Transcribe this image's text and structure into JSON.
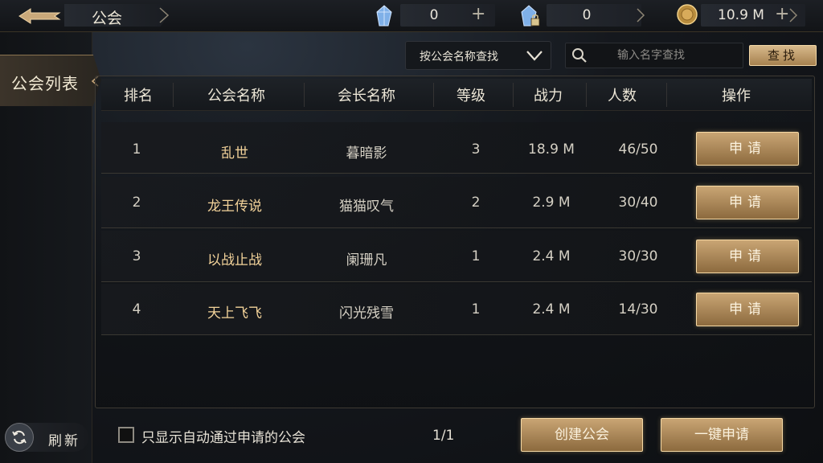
{
  "header": {
    "title": "公会",
    "currencies": [
      {
        "icon": "blue-crystal-icon",
        "value": "0",
        "has_plus": true
      },
      {
        "icon": "locked-crystal-icon",
        "value": "0",
        "has_plus": false
      },
      {
        "icon": "gold-coin-icon",
        "value": "10.9 M",
        "has_plus": true
      }
    ]
  },
  "side_tab": {
    "label": "公会列表"
  },
  "search": {
    "type_label": "按公会名称查找",
    "placeholder": "输入名字查找",
    "button_label": "查找"
  },
  "table": {
    "columns": [
      "排名",
      "公会名称",
      "会长名称",
      "等级",
      "战力",
      "人数",
      "操作"
    ],
    "rows": [
      {
        "rank": "1",
        "guild": "乱世",
        "leader": "暮暗影",
        "level": "3",
        "power": "18.9 M",
        "members": "46/50",
        "action": "申请"
      },
      {
        "rank": "2",
        "guild": "龙王传说",
        "leader": "猫猫叹气",
        "level": "2",
        "power": "2.9 M",
        "members": "30/40",
        "action": "申请"
      },
      {
        "rank": "3",
        "guild": "以战止战",
        "leader": "阑珊凡",
        "level": "1",
        "power": "2.4 M",
        "members": "30/30",
        "action": "申请"
      },
      {
        "rank": "4",
        "guild": "天上飞飞",
        "leader": "闪光残雪",
        "level": "1",
        "power": "2.4 M",
        "members": "14/30",
        "action": "申请"
      }
    ]
  },
  "footer": {
    "refresh_label": "刷新",
    "auto_filter_label": "只显示自动通过申请的公会",
    "auto_filter_checked": false,
    "page": "1/1",
    "create_label": "创建公会",
    "apply_all_label": "一键申请"
  },
  "colors": {
    "accent_gold": "#c9a574",
    "guild_name": "#f3d39a",
    "background": "#15181d"
  }
}
